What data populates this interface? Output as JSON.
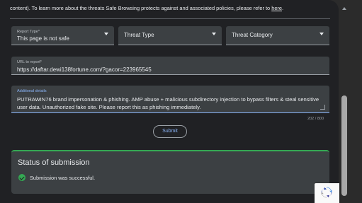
{
  "intro": {
    "text": "content). To learn more about the threats Safe Browsing protects against and associated policies, please refer to ",
    "link": "here",
    "end": "."
  },
  "report_type": {
    "label": "Report Type*",
    "value": "This page is not safe"
  },
  "threat_type": {
    "placeholder": "Threat Type"
  },
  "threat_category": {
    "placeholder": "Threat Category"
  },
  "url_field": {
    "label": "URL to report*",
    "value": "https://daftar.dewi138fortune.com/?gacor=223965545"
  },
  "details_field": {
    "label": "Additional details",
    "value": "PUTRAWIN76 brand impersonation & phishing. AMP abuse + malicious subdirectory injection to bypass filters & steal sensitive user data. Unauthorized fake site. Please report this as phishing immediately."
  },
  "counter": "202 / 800",
  "submit_label": "Submit",
  "status": {
    "title": "Status of submission",
    "message": "Submission was successful."
  },
  "colors": {
    "accent": "#8ab4f8",
    "success": "#34a853",
    "surface": "#3c4043",
    "background": "#202124"
  }
}
